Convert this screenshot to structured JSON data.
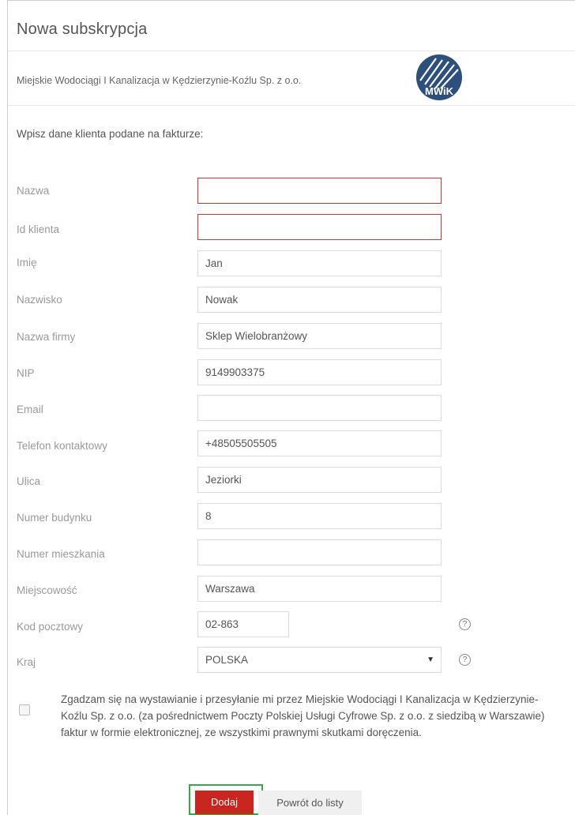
{
  "header": {
    "title": "Nowa subskrypcja"
  },
  "company": {
    "name": "Miejskie Wodociągi I Kanalizacja w Kędzierzynie-Koźlu Sp. z o.o.",
    "logo_text": "MWiK"
  },
  "form": {
    "instruction": "Wpisz dane klienta podane na fakturze:",
    "fields": [
      {
        "label": "Nazwa",
        "value": "",
        "error": true
      },
      {
        "label": "Id klienta",
        "value": "",
        "error": true
      },
      {
        "label": "Imię",
        "value": "Jan"
      },
      {
        "label": "Nazwisko",
        "value": "Nowak"
      },
      {
        "label": "Nazwa firmy",
        "value": "Sklep Wielobranżowy"
      },
      {
        "label": "NIP",
        "value": "9149903375"
      },
      {
        "label": "Email",
        "value": ""
      },
      {
        "label": "Telefon kontaktowy",
        "value": "+48505505505"
      },
      {
        "label": "Ulica",
        "value": "Jeziorki"
      },
      {
        "label": "Numer budynku",
        "value": "8"
      },
      {
        "label": "Numer mieszkania",
        "value": ""
      },
      {
        "label": "Miejscowość",
        "value": "Warszawa"
      },
      {
        "label": "Kod pocztowy",
        "value": "02-863"
      },
      {
        "label": "Kraj",
        "value": "POLSKA"
      }
    ],
    "help_glyph": "?",
    "select_arrow": "▼",
    "consent": "Zgadzam się na wystawianie i przesyłanie mi przez Miejskie Wodociągi I Kanalizacja w Kędzierzynie-Koźlu Sp. z o.o. (za pośrednictwem Poczty Polskiej Usługi Cyfrowe Sp. z o.o. z siedzibą w Warszawie) faktur w formie elektronicznej, ze wszystkimi prawnymi skutkami doręczenia."
  },
  "actions": {
    "add": "Dodaj",
    "back": "Powrót do listy"
  },
  "colors": {
    "error_border": "#c53a3a",
    "primary": "#c8261e",
    "focus_outline": "#3aa84a",
    "logo": "#2d4f7c"
  }
}
